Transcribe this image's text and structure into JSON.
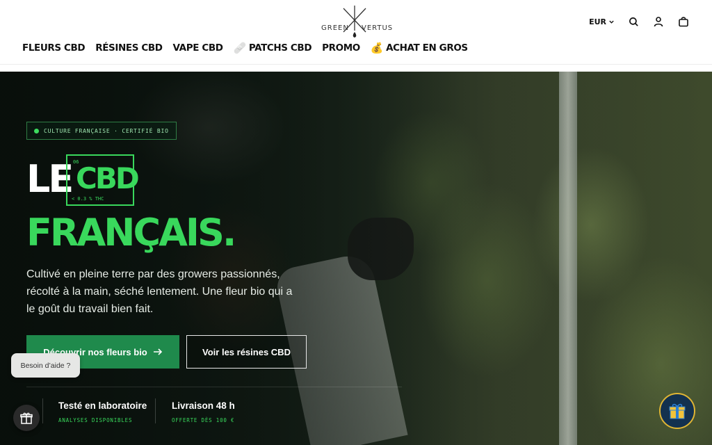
{
  "brand": {
    "left": "GREEN",
    "right": "VERTUS"
  },
  "nav": [
    {
      "label": "FLEURS CBD",
      "emoji": ""
    },
    {
      "label": "RÉSINES CBD",
      "emoji": ""
    },
    {
      "label": "VAPE CBD",
      "emoji": ""
    },
    {
      "label": "PATCHS CBD",
      "emoji": "🩹"
    },
    {
      "label": "PROMO",
      "emoji": ""
    },
    {
      "label": "ACHAT EN GROS",
      "emoji": "💰"
    }
  ],
  "header": {
    "currency": "EUR"
  },
  "hero": {
    "badge": "CULTURE FRANÇAISE · CERTIFIÉ BIO",
    "title_le": "LE",
    "cbd_code": "06",
    "cbd_word": "CBD",
    "cbd_sub": "< 0.3 % THC",
    "title_francais": "FRANÇAIS.",
    "description": "Cultivé en pleine terre par des growers passionnés, récolté à la main, séché lentement. Une fleur bio qui a le goût du travail bien fait.",
    "primary_button": "Découvrir nos fleurs bio",
    "secondary_button": "Voir les résines CBD",
    "features": [
      {
        "title": "Testé en laboratoire",
        "subtitle": "ANALYSES DISPONIBLES"
      },
      {
        "title": "Livraison 48 h",
        "subtitle": "OFFERTE DÈS 100 €"
      }
    ]
  },
  "help": {
    "label": "Besoin d’aide ?"
  },
  "colors": {
    "accent": "#39d85c",
    "button": "#1f8a4c",
    "hero_bg": "#0c1410"
  },
  "icons": [
    "search-icon",
    "account-icon",
    "cart-icon",
    "gift-icon",
    "arrow-right-icon"
  ]
}
